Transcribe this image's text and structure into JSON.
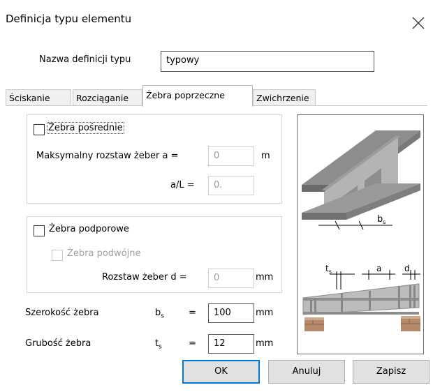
{
  "dialog": {
    "title": "Definicja typu elementu",
    "name_label": "Nazwa definicji typu",
    "name_value": "typowy"
  },
  "tabs": [
    {
      "label": "Ściskanie"
    },
    {
      "label": "Rozciąganie"
    },
    {
      "label": "Żebra poprzeczne"
    },
    {
      "label": "Zwichrzenie"
    }
  ],
  "intermediate": {
    "checkbox_label": "Żebra pośrednie",
    "checked": false,
    "max_spacing_label": "Maksymalny rozstaw żeber a =",
    "max_spacing_value": "0",
    "max_spacing_unit": "m",
    "ratio_label": "a/L =",
    "ratio_value": "0."
  },
  "support": {
    "checkbox_label": "Żebra podporowe",
    "checked": false,
    "double_label": "Żebra podwójne",
    "double_checked": false,
    "spacing_label": "Rozstaw żeber d =",
    "spacing_value": "0",
    "spacing_unit": "mm"
  },
  "width": {
    "label": "Szerokość żebra",
    "symbol": "b",
    "sub": "s",
    "eq": "=",
    "value": "100",
    "unit": "mm"
  },
  "thickness": {
    "label": "Grubość żebra",
    "symbol": "t",
    "sub": "s",
    "eq": "=",
    "value": "12",
    "unit": "mm"
  },
  "figure": {
    "label_bs": "b",
    "label_bs_sub": "s",
    "label_ts": "t",
    "label_ts_sub": "s",
    "label_a": "a",
    "label_d": "d"
  },
  "buttons": {
    "ok": "OK",
    "cancel": "Anuluj",
    "save": "Zapisz"
  }
}
